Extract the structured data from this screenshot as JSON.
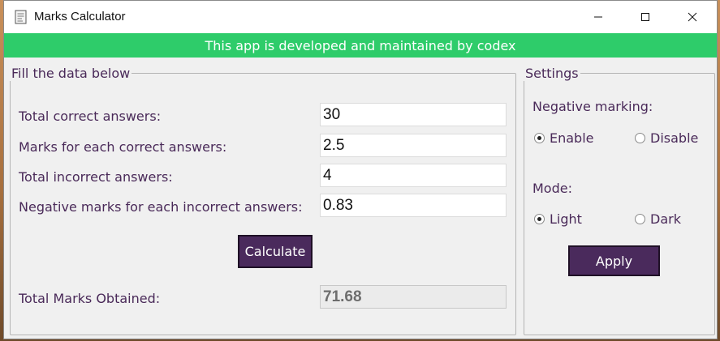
{
  "window": {
    "title": "Marks Calculator"
  },
  "banner": {
    "text": "This app is developed and maintained by codex"
  },
  "data_group": {
    "legend": "Fill the data below",
    "fields": [
      {
        "label": "Total correct answers:",
        "value": "30"
      },
      {
        "label": "Marks for each correct answers:",
        "value": "2.5"
      },
      {
        "label": "Total incorrect answers:",
        "value": "4"
      },
      {
        "label": "Negative marks for each incorrect answers:",
        "value": "0.83"
      }
    ],
    "calculate_label": "Calculate",
    "result_label": "Total Marks Obtained:",
    "result_value": "71.68"
  },
  "settings": {
    "legend": "Settings",
    "negative_marking": {
      "label": "Negative marking:",
      "options": [
        {
          "label": "Enable",
          "selected": true
        },
        {
          "label": "Disable",
          "selected": false
        }
      ]
    },
    "mode": {
      "label": "Mode:",
      "options": [
        {
          "label": "Light",
          "selected": true
        },
        {
          "label": "Dark",
          "selected": false
        }
      ]
    },
    "apply_label": "Apply"
  },
  "colors": {
    "banner": "#2ecc6a",
    "button": "#4a2a5c",
    "label_text": "#4a2a59"
  }
}
